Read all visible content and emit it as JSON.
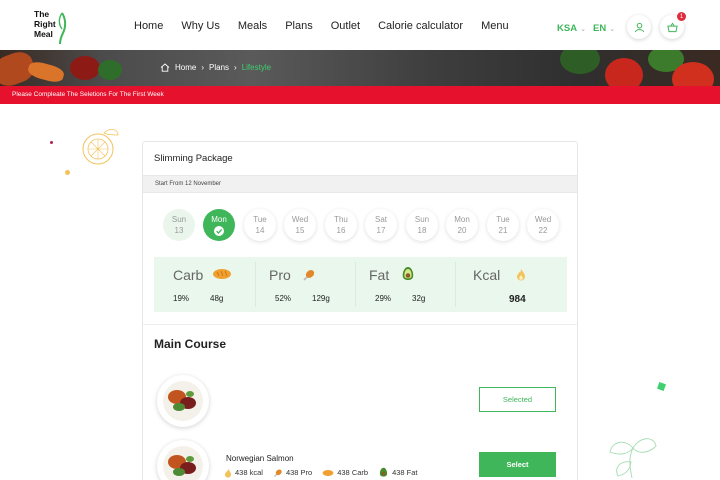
{
  "header": {
    "logo_lines": [
      "The",
      "Right",
      "Meal"
    ],
    "nav": [
      "Home",
      "Why Us",
      "Meals",
      "Plans",
      "Outlet",
      "Calorie calculator",
      "Menu"
    ],
    "region": "KSA",
    "language": "EN",
    "cart_count": "1"
  },
  "breadcrumb": {
    "home": "Home",
    "plans": "Plans",
    "current": "Lifestyle"
  },
  "alert": "Please Compleate The Seletions For The First Week",
  "package": {
    "title": "Slimming Package",
    "start": "Start From 12 November"
  },
  "days": [
    {
      "name": "Sun",
      "date": "13",
      "state": "past"
    },
    {
      "name": "Mon",
      "date": "",
      "state": "active"
    },
    {
      "name": "Tue",
      "date": "14",
      "state": "default"
    },
    {
      "name": "Wed",
      "date": "15",
      "state": "default"
    },
    {
      "name": "Thu",
      "date": "16",
      "state": "default"
    },
    {
      "name": "Sat",
      "date": "17",
      "state": "default"
    },
    {
      "name": "Sun",
      "date": "18",
      "state": "default"
    },
    {
      "name": "Mon",
      "date": "20",
      "state": "default"
    },
    {
      "name": "Tue",
      "date": "21",
      "state": "default"
    },
    {
      "name": "Wed",
      "date": "22",
      "state": "default"
    }
  ],
  "macros": {
    "carb": {
      "name": "Carb",
      "pct": "19%",
      "value": "48g",
      "icon": "bread-icon"
    },
    "pro": {
      "name": "Pro",
      "pct": "52%",
      "value": "129g",
      "icon": "drumstick-icon"
    },
    "fat": {
      "name": "Fat",
      "pct": "29%",
      "value": "32g",
      "icon": "avocado-icon"
    },
    "kcal": {
      "name": "Kcal",
      "value": "984",
      "icon": "flame-icon"
    }
  },
  "main_course": {
    "title": "Main Course",
    "meals": [
      {
        "name": "",
        "button": "Selected",
        "state": "selected"
      },
      {
        "name": "Norwegian Salmon",
        "kcal": "438 kcal",
        "pro": "438 Pro",
        "carb": "438 Carb",
        "fat": "438 Fat",
        "button": "Select",
        "state": "available"
      }
    ]
  },
  "colors": {
    "accent": "#3fb65a",
    "alert": "#e5112d",
    "macro_bg": "#e9f7ec"
  }
}
